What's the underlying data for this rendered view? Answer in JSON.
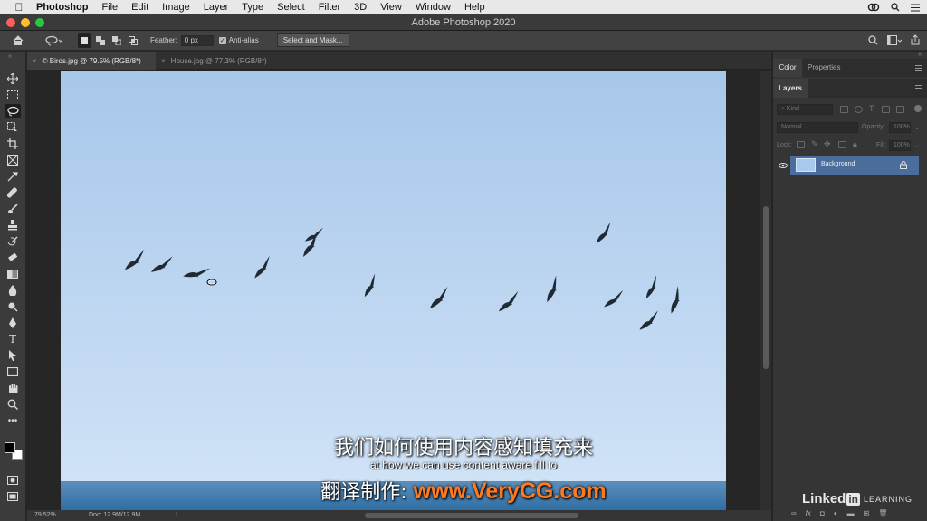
{
  "menubar": {
    "app_name": "Photoshop",
    "items": [
      "File",
      "Edit",
      "Image",
      "Layer",
      "Type",
      "Select",
      "Filter",
      "3D",
      "View",
      "Window",
      "Help"
    ]
  },
  "window": {
    "title": "Adobe Photoshop 2020"
  },
  "options": {
    "feather_label": "Feather:",
    "feather_value": "0 px",
    "antialias_label": "Anti-alias",
    "antialias_checked": true,
    "select_mask_label": "Select and Mask..."
  },
  "tabs": [
    {
      "label": "© Birds.jpg @ 79.5% (RGB/8*)",
      "active": true
    },
    {
      "label": "House.jpg @ 77.3% (RGB/8*)",
      "active": false
    }
  ],
  "status": {
    "zoom": "79.52%",
    "doc": "Doc: 12.9M/12.9M"
  },
  "panels": {
    "top_tabs": [
      "Color",
      "Properties"
    ],
    "layers_tab": "Layers",
    "kind_placeholder": "Kind",
    "blend_mode": "Normal",
    "opacity_label": "Opacity:",
    "opacity_value": "100%",
    "lock_label": "Lock:",
    "fill_label": "Fill:",
    "fill_value": "100%",
    "layer_name": "Background"
  },
  "subtitles": {
    "chinese": "我们如何使用内容感知填充来",
    "english": "at how we can use content aware fill to",
    "credit_prefix": "翻译制作: ",
    "credit_site": "www.VeryCG.com"
  },
  "watermark": {
    "brand": "Linked",
    "brand_in": "in",
    "suffix": "LEARNING"
  },
  "colors": {
    "accent_selected_layer": "#4a6d9c",
    "sky_top": "#a6c6ea",
    "sky_bottom": "#d0e3f7",
    "sea": "#2f6fa3",
    "credit_orange": "#ff7a1f"
  }
}
